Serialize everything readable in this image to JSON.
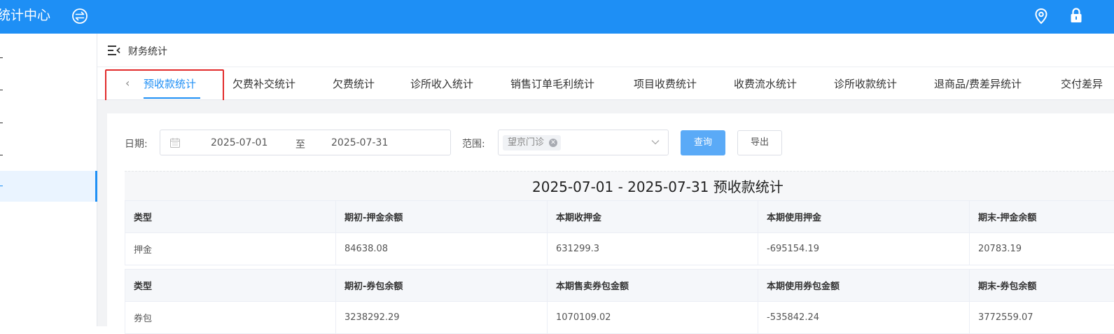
{
  "app": {
    "title": "统计中心"
  },
  "header": {
    "icons": [
      "switch-icon",
      "location-icon",
      "lock-icon"
    ]
  },
  "breadcrumb": {
    "title": "财务统计"
  },
  "tabs": [
    {
      "label": "预收款统计",
      "active": true
    },
    {
      "label": "欠费补交统计"
    },
    {
      "label": "欠费统计"
    },
    {
      "label": "诊所收入统计"
    },
    {
      "label": "销售订单毛利统计"
    },
    {
      "label": "项目收费统计"
    },
    {
      "label": "收费流水统计"
    },
    {
      "label": "诊所收款统计"
    },
    {
      "label": "退商品/费差异统计"
    },
    {
      "label": "交付差异"
    }
  ],
  "filters": {
    "date_label": "日期:",
    "start_date": "2025-07-01",
    "separator": "至",
    "end_date": "2025-07-31",
    "scope_label": "范围:",
    "scope_tag": "望京门诊",
    "query_button": "查询",
    "export_button": "导出"
  },
  "report": {
    "title": "2025-07-01 - 2025-07-31 预收款统计",
    "deposit_table": {
      "headers": [
        "类型",
        "期初-押金余额",
        "本期收押金",
        "本期使用押金",
        "期末-押金余额"
      ],
      "rows": [
        [
          "押金",
          "84638.08",
          "631299.3",
          "-695154.19",
          "20783.19"
        ]
      ]
    },
    "voucher_table": {
      "headers": [
        "类型",
        "期初-券包余额",
        "本期售卖券包金额",
        "本期使用券包金额",
        "期末-券包余额"
      ],
      "rows": [
        [
          "券包",
          "3238292.29",
          "1070109.02",
          "-535842.24",
          "3772559.07"
        ]
      ]
    }
  },
  "colors": {
    "primary": "#1e8ff5",
    "highlight_box": "#e22a2a",
    "button_query": "#5aaaf7"
  }
}
